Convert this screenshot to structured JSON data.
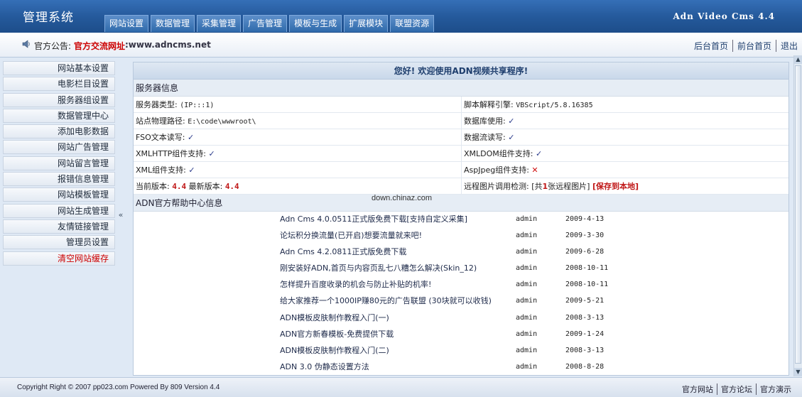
{
  "header": {
    "app_title": "管理系统",
    "version": "Adn Video Cms 4.4",
    "tabs": [
      {
        "label": "网站设置"
      },
      {
        "label": "数据管理"
      },
      {
        "label": "采集管理"
      },
      {
        "label": "广告管理"
      },
      {
        "label": "模板与生成"
      },
      {
        "label": "扩展模块"
      },
      {
        "label": "联盟资源"
      }
    ]
  },
  "notice": {
    "label": "官方公告:",
    "link_text": "官方交流网址",
    "url_text": ":www.adncms.net",
    "quicklinks": [
      {
        "label": "后台首页"
      },
      {
        "label": "前台首页"
      },
      {
        "label": "退出"
      }
    ]
  },
  "sidebar": {
    "items": [
      {
        "label": "网站基本设置"
      },
      {
        "label": "电影栏目设置"
      },
      {
        "label": "服务器组设置"
      },
      {
        "label": "数据管理中心"
      },
      {
        "label": "添加电影数据"
      },
      {
        "label": "网站广告管理"
      },
      {
        "label": "网站留言管理"
      },
      {
        "label": "报错信息管理"
      },
      {
        "label": "网站模板管理"
      },
      {
        "label": "网站生成管理"
      },
      {
        "label": "友情链接管理"
      },
      {
        "label": "管理员设置"
      },
      {
        "label": "清空网站缓存"
      }
    ],
    "collapse_glyph": "«"
  },
  "main": {
    "welcome": "您好! 欢迎使用ADN视频共享程序!",
    "server_section": "服务器信息",
    "info": {
      "server_type_label": "服务器类型:",
      "server_type_value": "(IP:::1)",
      "script_engine_label": "脚本解释引擎:",
      "script_engine_value": "VBScript/5.8.16385",
      "physical_path_label": "站点物理路径:",
      "physical_path_value": "E:\\code\\wwwroot\\",
      "database_label": "数据库使用:",
      "fso_label": "FSO文本读写:",
      "stream_label": "数据流读写:",
      "xmlhttp_label": "XMLHTTP组件支持:",
      "xmldom_label": "XMLDOM组件支持:",
      "xml_label": "XML组件支持:",
      "aspjpeg_label": "AspJpeg组件支持:",
      "check_mark": "✓",
      "cross_mark": "✕",
      "current_version_label": "当前版本:",
      "current_version": "4.4",
      "latest_version_label": "最新版本:",
      "latest_version": "4.4",
      "remote_img_label": "远程图片调用检测:",
      "remote_img_prefix": "[共",
      "remote_img_count": "1",
      "remote_img_suffix": "张远程图片]",
      "save_local": "[保存到本地]"
    },
    "help_section": "ADN官方帮助中心信息",
    "watermark": "down.chinaz.com",
    "news": [
      {
        "title": "Adn Cms 4.0.0511正式版免费下载[支持自定义采集]",
        "author": "admin",
        "date": "2009-4-13"
      },
      {
        "title": "论坛积分换流量(已开启)想要流量就来吧!",
        "author": "admin",
        "date": "2009-3-30"
      },
      {
        "title": "Adn Cms 4.2.0811正式版免费下载",
        "author": "admin",
        "date": "2009-6-28"
      },
      {
        "title": "刚安装好ADN,首页与内容页乱七八糟怎么解决(Skin_12)",
        "author": "admin",
        "date": "2008-10-11"
      },
      {
        "title": "怎样提升百度收录的机会与防止补贴的机率!",
        "author": "admin",
        "date": "2008-10-11"
      },
      {
        "title": "给大家推荐一个1000IP赚80元的广告联盟 (30块就可以收钱)",
        "author": "admin",
        "date": "2009-5-21"
      },
      {
        "title": "ADN模板皮肤制作教程入门(一)",
        "author": "admin",
        "date": "2008-3-13"
      },
      {
        "title": "ADN官方新春模板-免费提供下载",
        "author": "admin",
        "date": "2009-1-24"
      },
      {
        "title": "ADN模板皮肤制作教程入门(二)",
        "author": "admin",
        "date": "2008-3-13"
      },
      {
        "title": "ADN 3.0 伪静态设置方法",
        "author": "admin",
        "date": "2008-8-28"
      }
    ]
  },
  "footer": {
    "copyright": "Copyright Right © 2007 pp023.com Powered By 809 Version 4.4",
    "links": [
      {
        "label": "官方网站"
      },
      {
        "label": "官方论坛"
      },
      {
        "label": "官方演示"
      }
    ]
  },
  "colors": {
    "header_blue": "#255a9c",
    "alert_red": "#cc0000",
    "check_blue": "#2a3a8a"
  }
}
